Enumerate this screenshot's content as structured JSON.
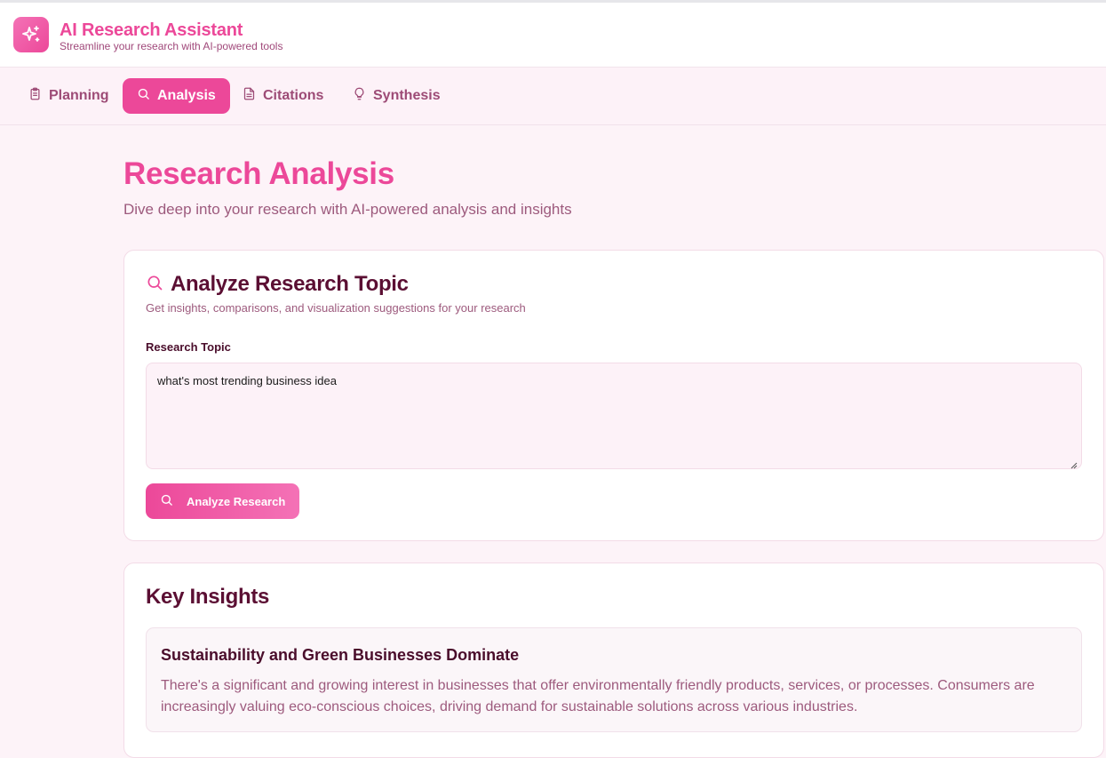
{
  "app": {
    "title": "AI Research Assistant",
    "subtitle": "Streamline your research with AI-powered tools"
  },
  "nav": {
    "tabs": [
      {
        "label": "Planning",
        "icon": "clipboard-icon",
        "active": false
      },
      {
        "label": "Analysis",
        "icon": "search-icon",
        "active": true
      },
      {
        "label": "Citations",
        "icon": "document-icon",
        "active": false
      },
      {
        "label": "Synthesis",
        "icon": "lightbulb-icon",
        "active": false
      }
    ]
  },
  "page": {
    "title": "Research Analysis",
    "description": "Dive deep into your research with AI-powered analysis and insights"
  },
  "analyze_card": {
    "title": "Analyze Research Topic",
    "description": "Get insights, comparisons, and visualization suggestions for your research",
    "field_label": "Research Topic",
    "topic_value": "what's most trending business idea",
    "button_label": "Analyze Research"
  },
  "insights": {
    "title": "Key Insights",
    "items": [
      {
        "title": "Sustainability and Green Businesses Dominate",
        "body": "There's a significant and growing interest in businesses that offer environmentally friendly products, services, or processes. Consumers are increasingly valuing eco-conscious choices, driving demand for sustainable solutions across various industries."
      }
    ]
  },
  "colors": {
    "accent": "#ec4899",
    "heading": "#5b0f33",
    "muted": "#9d5a7d",
    "background": "#fdf3f8"
  }
}
